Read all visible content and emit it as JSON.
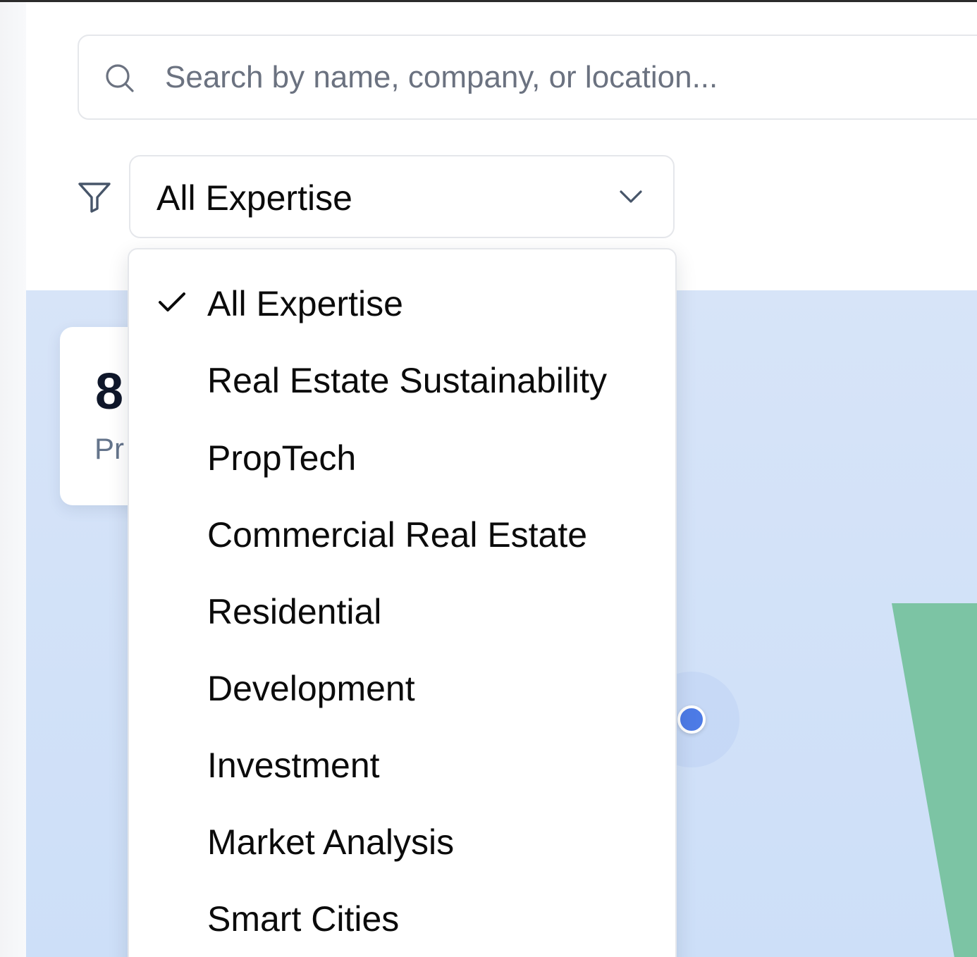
{
  "search": {
    "placeholder": "Search by name, company, or location...",
    "value": ""
  },
  "filter": {
    "selected": "All Expertise",
    "options": [
      {
        "label": "All Expertise",
        "checked": true
      },
      {
        "label": "Real Estate Sustainability",
        "checked": false
      },
      {
        "label": "PropTech",
        "checked": false
      },
      {
        "label": "Commercial Real Estate",
        "checked": false
      },
      {
        "label": "Residential",
        "checked": false
      },
      {
        "label": "Development",
        "checked": false
      },
      {
        "label": "Investment",
        "checked": false
      },
      {
        "label": "Market Analysis",
        "checked": false
      },
      {
        "label": "Smart Cities",
        "checked": false
      }
    ]
  },
  "stats": {
    "number_visible": "8",
    "label_visible": "Pr"
  },
  "icons": {
    "search": "search-icon",
    "filter": "filter-icon",
    "chevron": "chevron-down-icon",
    "check": "check-icon"
  },
  "colors": {
    "map_water": "#d3e2f8",
    "map_land": "#7cc4a4",
    "marker": "#4d7be6",
    "text_primary": "#0b0b0b",
    "text_muted": "#6b7280",
    "border": "#e5e7eb"
  }
}
